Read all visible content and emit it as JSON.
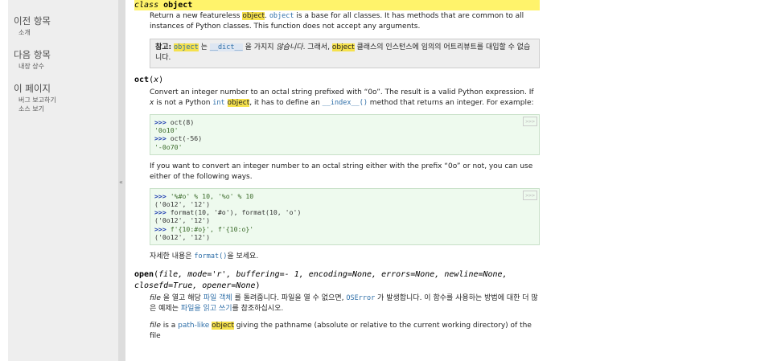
{
  "sidebar": {
    "prev": {
      "heading": "이전 항목",
      "link": "소개"
    },
    "next": {
      "heading": "다음 항목",
      "link": "내장 상수"
    },
    "page": {
      "heading": "이 페이지",
      "links": [
        "버그 보고하기",
        "소스 보기"
      ]
    }
  },
  "collapse_glyph": "«",
  "object": {
    "kw": "class",
    "name": "object",
    "desc_before": "Return a new featureless ",
    "desc_hl": "object",
    "desc_code": "object",
    "desc_after": " is a base for all classes. It has methods that are common to all instances of Python classes. This function does not accept any arguments.",
    "note_label": "참고:",
    "note_obj": "object",
    "note_p1": " 는 ",
    "note_dict": "__dict__",
    "note_p2": " 을 가지지 ",
    "note_em": "않습니다",
    "note_p3": ". 그래서, ",
    "note_obj2": "object",
    "note_p4": " 클래스의 인스턴스에 임의의 어트리뷰트를 대입할 수 없습니다."
  },
  "oct": {
    "name": "oct",
    "arg": "x",
    "d1": "Convert an integer number to an octal string prefixed with “0o”. The result is a valid Python expression. If ",
    "d1_x": "x",
    "d1b": " is not a Python ",
    "d1_int": "int",
    "d1_obj": "object",
    "d1c": ", it has to define an ",
    "d1_index": "__index__()",
    "d1d": " method that returns an integer. For example:",
    "code1": [
      {
        "p": ">>> ",
        "c": "oct(8)"
      },
      {
        "p": "",
        "c": "'0o10'"
      },
      {
        "p": ">>> ",
        "c": "oct(-56)"
      },
      {
        "p": "",
        "c": "'-0o70'"
      }
    ],
    "d2": "If you want to convert an integer number to an octal string either with the prefix “0o” or not, you can use either of the following ways.",
    "code2": [
      {
        "p": ">>> ",
        "c": "'%#o' % 10, '%o' % 10"
      },
      {
        "p": "",
        "c": "('0o12', '12')"
      },
      {
        "p": ">>> ",
        "c": "format(10, '#o'), format(10, 'o')"
      },
      {
        "p": "",
        "c": "('0o12', '12')"
      },
      {
        "p": ">>> ",
        "c": "f'{10:#o}', f'{10:o}'"
      },
      {
        "p": "",
        "c": "('0o12', '12')"
      }
    ],
    "copy": ">>>",
    "d3_before": "자세한 내용은 ",
    "d3_link": "format()",
    "d3_after": "을 보세요."
  },
  "open": {
    "name": "open",
    "sig_args": "file, mode='r', buffering=- 1, encoding=None, errors=None, newline=None,",
    "sig_args2": "closefd=True, opener=None",
    "d1_file": "file",
    "d1a": " 을 열고 해당 ",
    "d1_link": "파일 객체",
    "d1b": " 를 돌려줍니다. 파일을 열 수 없으면, ",
    "d1_err": "OSError",
    "d1c": " 가 발생합니다. 이 함수를 사용하는 방법에 대한 더 많은 예제는 ",
    "d1_link2": "파일을 읽고 쓰기",
    "d1d": "를 참조하십시오.",
    "d2_file": "file",
    "d2a": " is a ",
    "d2_link": "path-like",
    "d2_hl": "object",
    "d2b": " giving the pathname (absolute or relative to the current working directory) of the file"
  }
}
